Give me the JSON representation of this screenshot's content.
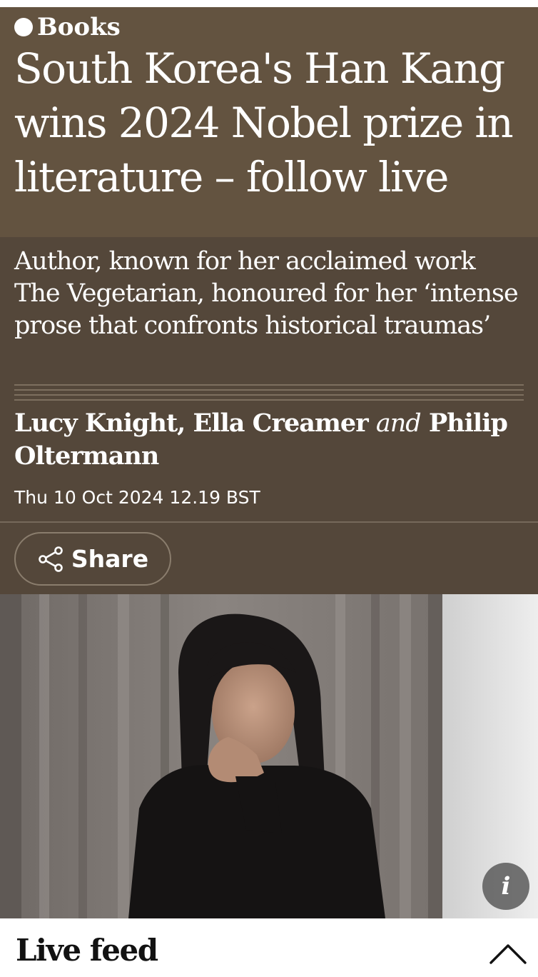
{
  "article": {
    "section": "Books",
    "headline": "South Korea's Han Kang wins 2024 Nobel prize in literature – follow live",
    "standfirst": "Author, known for her acclaimed work The Vegetarian, honoured for her ‘intense prose that confronts historical traumas’",
    "byline": {
      "author1": "Lucy Knight",
      "separator": ", ",
      "author2": "Ella Creamer",
      "conjunction": "and",
      "author3": "Philip Oltermann"
    },
    "timestamp": "Thu 10 Oct 2024 12.19 BST"
  },
  "actions": {
    "share_label": "Share",
    "info_label": "i"
  },
  "live_feed": {
    "title": "Live feed"
  },
  "icons": {
    "share": "share-icon",
    "info": "info-icon",
    "collapse": "chevron-up-icon"
  },
  "colors": {
    "header_top": "#635340",
    "header_bottom": "#54473a",
    "text": "#ffffff",
    "live_bar_bg": "#ffffff"
  }
}
